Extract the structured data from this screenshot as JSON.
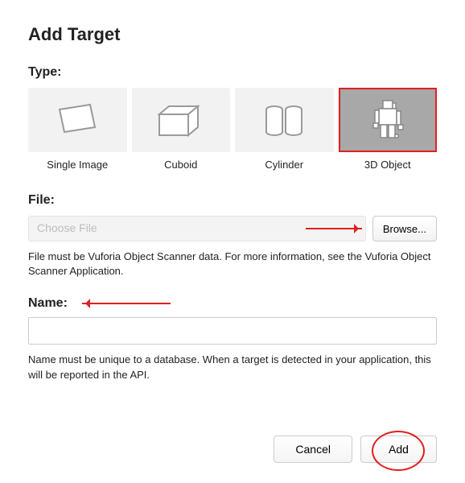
{
  "title": "Add Target",
  "type_section": {
    "label": "Type:",
    "tiles": [
      {
        "label": "Single Image"
      },
      {
        "label": "Cuboid"
      },
      {
        "label": "Cylinder"
      },
      {
        "label": "3D Object"
      }
    ]
  },
  "file_section": {
    "label": "File:",
    "placeholder": "Choose File",
    "browse_label": "Browse...",
    "helper": "File must be Vuforia Object Scanner data. For more information, see the Vuforia Object Scanner Application."
  },
  "name_section": {
    "label": "Name:",
    "value": "",
    "helper": "Name must be unique to a database. When a target is detected in your application, this will be reported in the API."
  },
  "buttons": {
    "cancel": "Cancel",
    "add": "Add"
  }
}
